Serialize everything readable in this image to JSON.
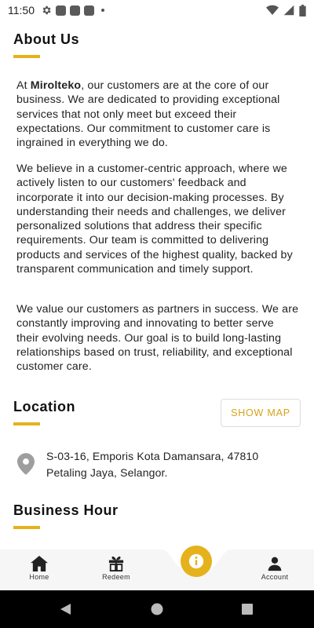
{
  "status_bar": {
    "time": "11:50"
  },
  "about": {
    "title": "About Us",
    "p1_prefix": "At ",
    "p1_brand": "Mirolteko",
    "p1_rest": ", our customers are at the core of our business. We are dedicated to providing exceptional services that not only meet but exceed their expectations. Our commitment to customer care is ingrained in everything we do.",
    "p2": "We believe in a customer-centric approach, where we actively listen to our customers' feedback and incorporate it into our decision-making processes. By understanding their needs and challenges, we deliver personalized solutions that address their specific requirements. Our team is committed to delivering products and services of the highest quality, backed by transparent communication and timely support.",
    "p3": "We value our customers as partners in success. We are constantly improving and innovating to better serve their evolving needs. Our goal is to build long-lasting relationships based on trust, reliability, and exceptional customer care."
  },
  "location": {
    "title": "Location",
    "show_map_label": "SHOW MAP",
    "address_line1": "S-03-16, Emporis Kota Damansara, 47810",
    "address_line2": "Petaling Jaya, Selangor."
  },
  "business_hour": {
    "title": "Business Hour"
  },
  "bottom_nav": {
    "home": "Home",
    "redeem": "Redeem",
    "account": "Account"
  },
  "colors": {
    "accent": "#e5b21c",
    "nav_bg": "#f6f6f6"
  }
}
